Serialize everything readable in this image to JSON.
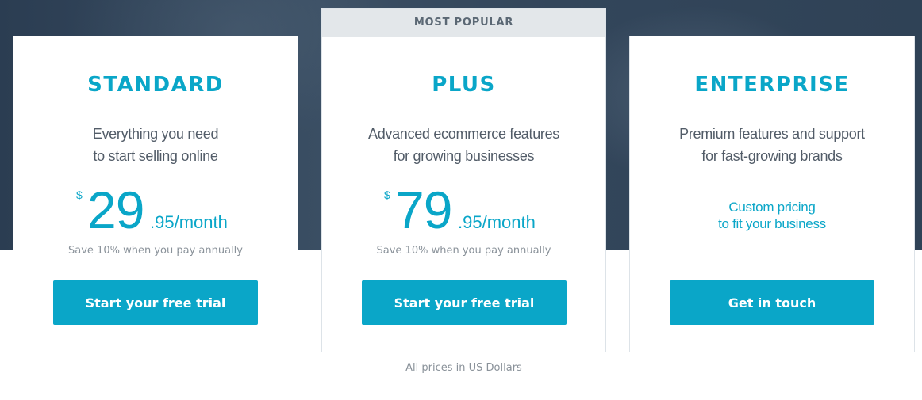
{
  "hero": {
    "background": "#2f4256"
  },
  "accent_color": "#0aa6c8",
  "plans": [
    {
      "name": "STANDARD",
      "description": [
        "Everything you need",
        "to start selling online"
      ],
      "currency": "$",
      "amount": "29",
      "suffix": ".95/month",
      "save_note": "Save 10% when you pay annually",
      "cta_label": "Start your free trial"
    },
    {
      "banner": "MOST POPULAR",
      "name": "PLUS",
      "description": [
        "Advanced ecommerce features",
        "for growing businesses"
      ],
      "currency": "$",
      "amount": "79",
      "suffix": ".95/month",
      "save_note": "Save 10% when you pay annually",
      "cta_label": "Start your free trial"
    },
    {
      "name": "ENTERPRISE",
      "description": [
        "Premium features and support",
        "for fast-growing brands"
      ],
      "custom_pricing": [
        "Custom pricing",
        "to fit your business"
      ],
      "cta_label": "Get in touch"
    }
  ],
  "footnote": "All prices in US Dollars"
}
